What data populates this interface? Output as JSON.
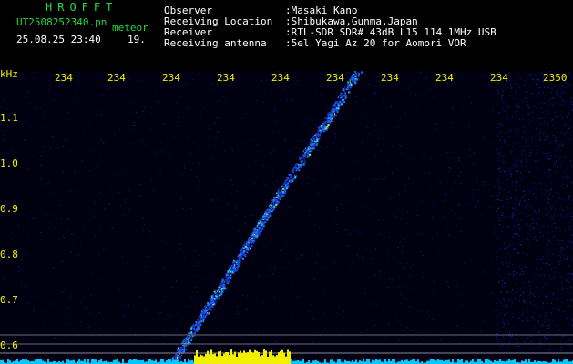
{
  "header": {
    "logo": "HROFFT",
    "filename": "UT2508252340.pn",
    "mode": "meteor",
    "datetime": "25.08.25 23:40",
    "count": "19.",
    "info": [
      {
        "label": "Observer",
        "value": ":Masaki Kano"
      },
      {
        "label": "Receiving Location",
        "value": ":Shibukawa,Gunma,Japan"
      },
      {
        "label": "Receiver",
        "value": ":RTL-SDR SDR# 43dB L15 114.1MHz USB"
      },
      {
        "label": "Receiving antenna",
        "value": ":5el Yagi Az 20 for Aomori VOR"
      }
    ]
  },
  "axes": {
    "y_unit": "kHz",
    "x_ticks": [
      "234",
      "234",
      "234",
      "234",
      "234",
      "234",
      "234",
      "234",
      "234",
      "2350"
    ],
    "y_ticks": [
      "1.1",
      "1.0",
      "0.9",
      "0.8",
      "0.7",
      "0.6"
    ]
  },
  "colors": {
    "background": "#000000",
    "header_green": "#1edc3c",
    "tick_yellow": "#f0f000",
    "signal_cyan": "#00c8ff",
    "noise_blue": "#0a1a8c"
  }
}
